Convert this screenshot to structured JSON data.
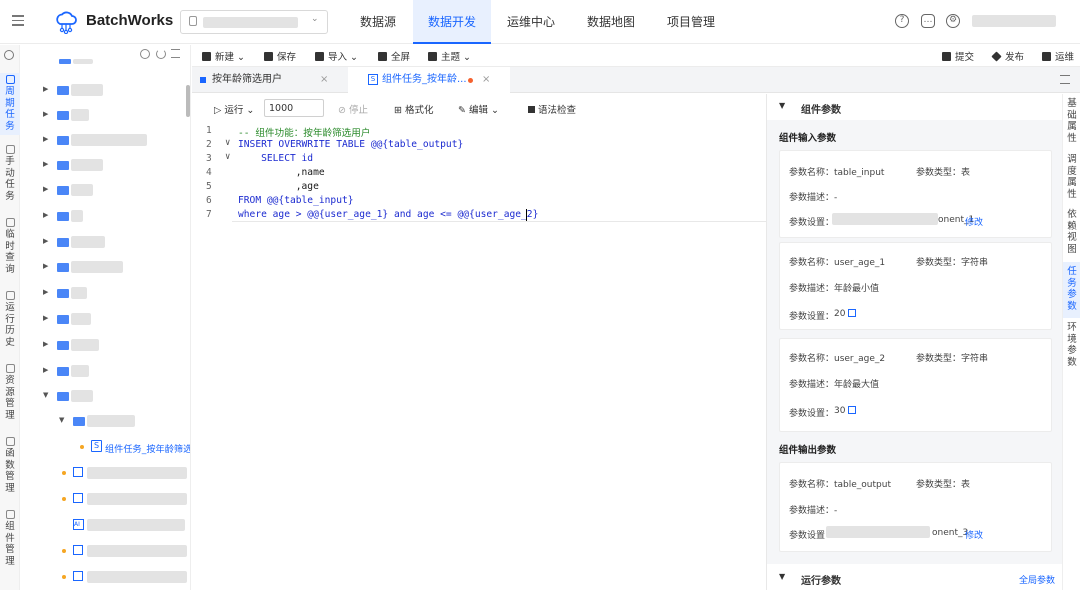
{
  "header": {
    "brand": "BatchWorks",
    "nav": [
      "数据源",
      "数据开发",
      "运维中心",
      "数据地图",
      "项目管理"
    ],
    "active_nav": "数据开发"
  },
  "leftnav": {
    "items": [
      {
        "label": "周\n期\n任\n务",
        "active": true
      },
      {
        "label": "手\n动\n任\n务",
        "active": false
      },
      {
        "label": "临\n时\n查\n询",
        "active": false
      },
      {
        "label": "运\n行\n历\n史",
        "active": false
      },
      {
        "label": "资\n源\n管\n理",
        "active": false
      },
      {
        "label": "函\n数\n管\n理",
        "active": false
      },
      {
        "label": "组\n件\n管\n理",
        "active": false
      }
    ]
  },
  "tree": {
    "selected_item": "组件任务_按年龄筛选"
  },
  "toolbar": {
    "new": "新建",
    "save": "保存",
    "import": "导入",
    "fullscreen": "全屏",
    "theme": "主题",
    "submit": "提交",
    "publish": "发布",
    "ops": "运维"
  },
  "tabs": [
    {
      "label": "按年龄筛选用户",
      "active": false
    },
    {
      "label": "组件任务_按年龄...",
      "active": true
    }
  ],
  "editor_toolbar": {
    "run": "运行",
    "limit": "1000",
    "stop": "停止",
    "format": "格式化",
    "edit": "编辑",
    "syntax": "语法检查"
  },
  "code_lines": [
    "-- 组件功能：按年龄筛选用户",
    "INSERT OVERWRITE TABLE @@{table_output}",
    "    SELECT id",
    "          ,name",
    "          ,age",
    "FROM @@{table_input}",
    "where age > @@{user_age_1} and age <= @@{user_age_2}"
  ],
  "line_numbers": [
    "1",
    "2",
    "3",
    "4",
    "5",
    "6",
    "7"
  ],
  "right_panel": {
    "title": "组件参数",
    "input_title": "组件输入参数",
    "output_title": "组件输出参数",
    "run_title": "运行参数",
    "global": "全局参数",
    "params": [
      {
        "name": "参数名称：table_input",
        "type": "参数类型：表",
        "desc": "参数描述：-",
        "setting_label": "参数设置：",
        "setting_value": "onent_1",
        "modify": "修改"
      },
      {
        "name": "参数名称：user_age_1",
        "type": "参数类型：字符串",
        "desc": "参数描述：年龄最小值",
        "setting_label": "参数设置：",
        "setting_value": "20"
      },
      {
        "name": "参数名称：user_age_2",
        "type": "参数类型：字符串",
        "desc": "参数描述：年龄最大值",
        "setting_label": "参数设置：",
        "setting_value": "30"
      }
    ],
    "output": {
      "name": "参数名称：table_output",
      "type": "参数类型：表",
      "desc": "参数描述：-",
      "setting_label": "参数设置",
      "setting_value": "onent_3",
      "modify": "修改"
    }
  },
  "right_tabs": [
    {
      "label": "基\n础\n属\n性",
      "active": false
    },
    {
      "label": "调\n度\n属\n性",
      "active": false
    },
    {
      "label": "依\n赖\n视\n图",
      "active": false
    },
    {
      "label": "任\n务\n参\n数",
      "active": true
    },
    {
      "label": "环\n境\n参\n数",
      "active": false
    }
  ],
  "colors": {
    "accent": "#1a66ff",
    "active_bg": "#e8f0fe",
    "folder": "#4a86f7"
  }
}
